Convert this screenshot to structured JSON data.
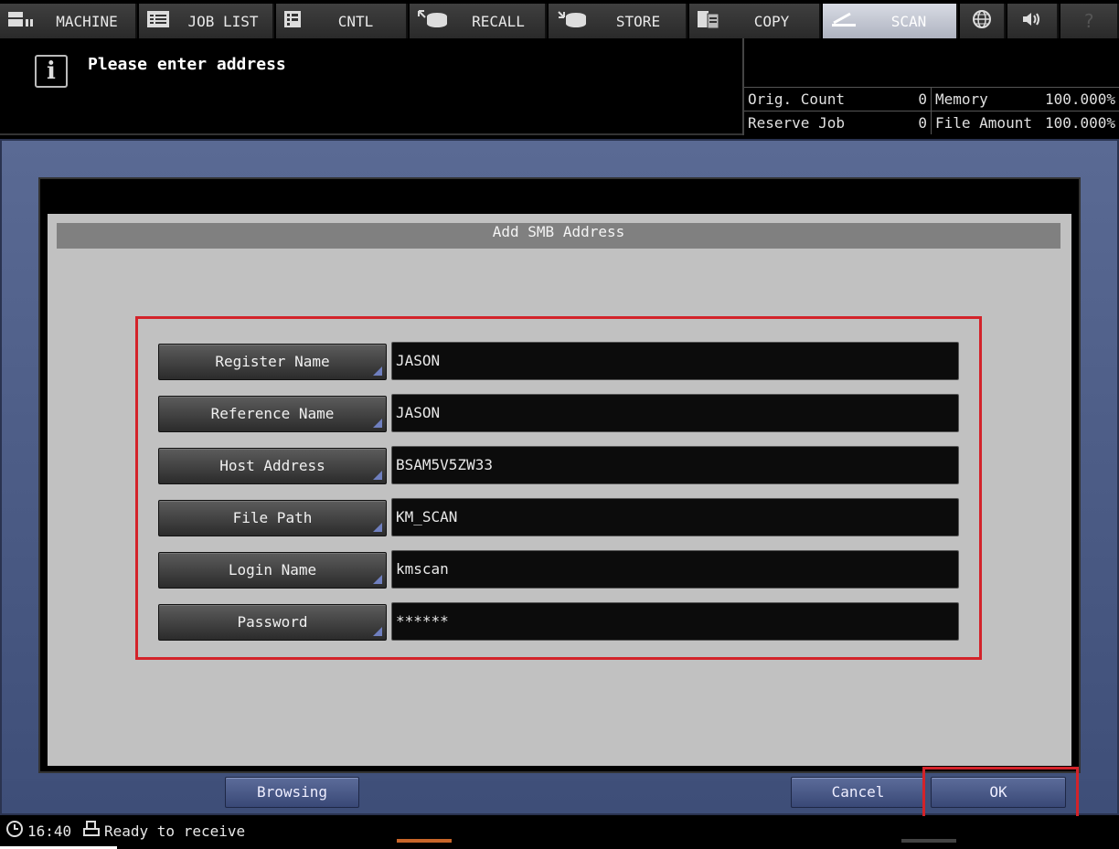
{
  "tabs": [
    {
      "label": "MACHINE",
      "icon": "machine-icon"
    },
    {
      "label": "JOB LIST",
      "icon": "job-list-icon"
    },
    {
      "label": "CNTL",
      "icon": "cntl-icon"
    },
    {
      "label": "RECALL",
      "icon": "recall-icon"
    },
    {
      "label": "STORE",
      "icon": "store-icon"
    },
    {
      "label": "COPY",
      "icon": "copy-icon"
    },
    {
      "label": "SCAN",
      "icon": "scan-icon"
    }
  ],
  "message": {
    "icon": "i",
    "text": "Please enter address"
  },
  "status": {
    "orig_count_label": "Orig. Count",
    "orig_count_value": "0",
    "reserve_job_label": "Reserve Job",
    "reserve_job_value": "0",
    "memory_label": "Memory",
    "memory_value": "100.000%",
    "file_amount_label": "File Amount",
    "file_amount_value": "100.000%"
  },
  "dialog": {
    "title": "Add SMB Address",
    "fields": [
      {
        "label": "Register Name",
        "value": "JASON"
      },
      {
        "label": "Reference Name",
        "value": "JASON"
      },
      {
        "label": "Host Address",
        "value": "BSAM5V5ZW33"
      },
      {
        "label": "File Path",
        "value": "KM_SCAN"
      },
      {
        "label": "Login Name",
        "value": "kmscan"
      },
      {
        "label": "Password",
        "value": "******"
      }
    ],
    "browse_label": "Browsing",
    "cancel_label": "Cancel",
    "ok_label": "OK"
  },
  "statusbar": {
    "time": "16:40",
    "state": "Ready to receive"
  },
  "colors": {
    "highlight": "#d3232a",
    "accent_blue": "#4a5a88"
  }
}
